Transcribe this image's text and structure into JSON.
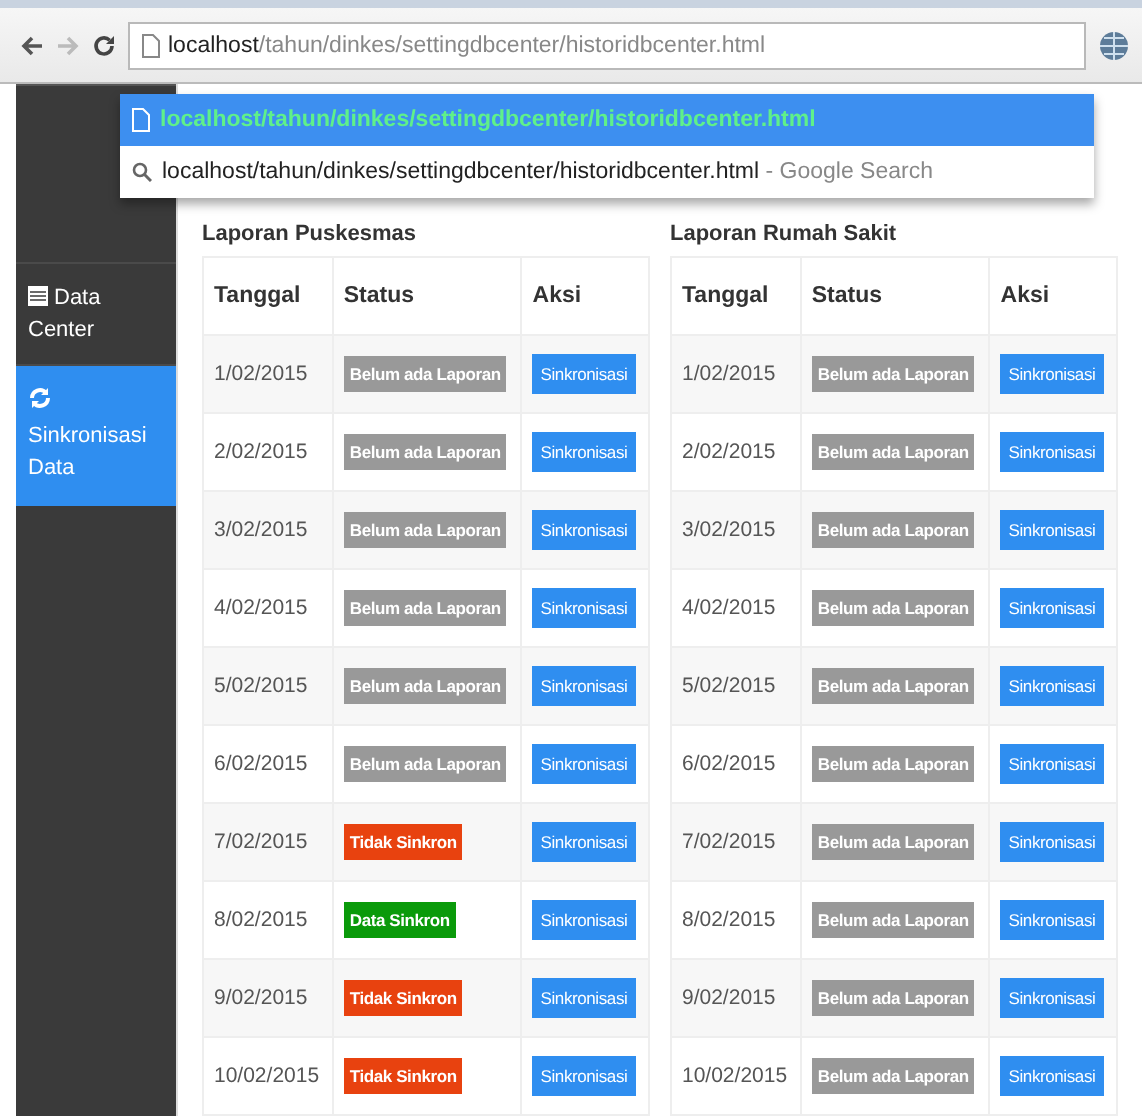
{
  "address_bar": {
    "host": "localhost",
    "path": "/tahun/dinkes/settingdbcenter/historidbcenter.html"
  },
  "suggestions": [
    {
      "kind": "url",
      "text": "localhost/tahun/dinkes/settingdbcenter/historidbcenter.html",
      "selected": true
    },
    {
      "kind": "search",
      "text": "localhost/tahun/dinkes/settingdbcenter/historidbcenter.html",
      "hint": "- Google Search",
      "selected": false
    }
  ],
  "sidebar": {
    "items": [
      {
        "kind": "table",
        "label": "Data Center",
        "selected": false
      },
      {
        "kind": "sync",
        "label": "Sinkronisasi Data",
        "selected": true
      }
    ]
  },
  "tables": [
    {
      "title": "Laporan Puskesmas",
      "columns": [
        "Tanggal",
        "Status",
        "Aksi"
      ],
      "rows": [
        {
          "date": "1/02/2015",
          "status": {
            "kind": "none",
            "text": "Belum ada Laporan"
          },
          "action": "Sinkronisasi"
        },
        {
          "date": "2/02/2015",
          "status": {
            "kind": "none",
            "text": "Belum ada Laporan"
          },
          "action": "Sinkronisasi"
        },
        {
          "date": "3/02/2015",
          "status": {
            "kind": "none",
            "text": "Belum ada Laporan"
          },
          "action": "Sinkronisasi"
        },
        {
          "date": "4/02/2015",
          "status": {
            "kind": "none",
            "text": "Belum ada Laporan"
          },
          "action": "Sinkronisasi"
        },
        {
          "date": "5/02/2015",
          "status": {
            "kind": "none",
            "text": "Belum ada Laporan"
          },
          "action": "Sinkronisasi"
        },
        {
          "date": "6/02/2015",
          "status": {
            "kind": "none",
            "text": "Belum ada Laporan"
          },
          "action": "Sinkronisasi"
        },
        {
          "date": "7/02/2015",
          "status": {
            "kind": "failed",
            "text": "Tidak Sinkron"
          },
          "action": "Sinkronisasi"
        },
        {
          "date": "8/02/2015",
          "status": {
            "kind": "synced",
            "text": "Data Sinkron"
          },
          "action": "Sinkronisasi"
        },
        {
          "date": "9/02/2015",
          "status": {
            "kind": "failed",
            "text": "Tidak Sinkron"
          },
          "action": "Sinkronisasi"
        },
        {
          "date": "10/02/2015",
          "status": {
            "kind": "failed",
            "text": "Tidak Sinkron"
          },
          "action": "Sinkronisasi"
        }
      ]
    },
    {
      "title": "Laporan Rumah Sakit",
      "columns": [
        "Tanggal",
        "Status",
        "Aksi"
      ],
      "rows": [
        {
          "date": "1/02/2015",
          "status": {
            "kind": "none",
            "text": "Belum ada Laporan"
          },
          "action": "Sinkronisasi"
        },
        {
          "date": "2/02/2015",
          "status": {
            "kind": "none",
            "text": "Belum ada Laporan"
          },
          "action": "Sinkronisasi"
        },
        {
          "date": "3/02/2015",
          "status": {
            "kind": "none",
            "text": "Belum ada Laporan"
          },
          "action": "Sinkronisasi"
        },
        {
          "date": "4/02/2015",
          "status": {
            "kind": "none",
            "text": "Belum ada Laporan"
          },
          "action": "Sinkronisasi"
        },
        {
          "date": "5/02/2015",
          "status": {
            "kind": "none",
            "text": "Belum ada Laporan"
          },
          "action": "Sinkronisasi"
        },
        {
          "date": "6/02/2015",
          "status": {
            "kind": "none",
            "text": "Belum ada Laporan"
          },
          "action": "Sinkronisasi"
        },
        {
          "date": "7/02/2015",
          "status": {
            "kind": "none",
            "text": "Belum ada Laporan"
          },
          "action": "Sinkronisasi"
        },
        {
          "date": "8/02/2015",
          "status": {
            "kind": "none",
            "text": "Belum ada Laporan"
          },
          "action": "Sinkronisasi"
        },
        {
          "date": "9/02/2015",
          "status": {
            "kind": "none",
            "text": "Belum ada Laporan"
          },
          "action": "Sinkronisasi"
        },
        {
          "date": "10/02/2015",
          "status": {
            "kind": "none",
            "text": "Belum ada Laporan"
          },
          "action": "Sinkronisasi"
        }
      ]
    }
  ]
}
